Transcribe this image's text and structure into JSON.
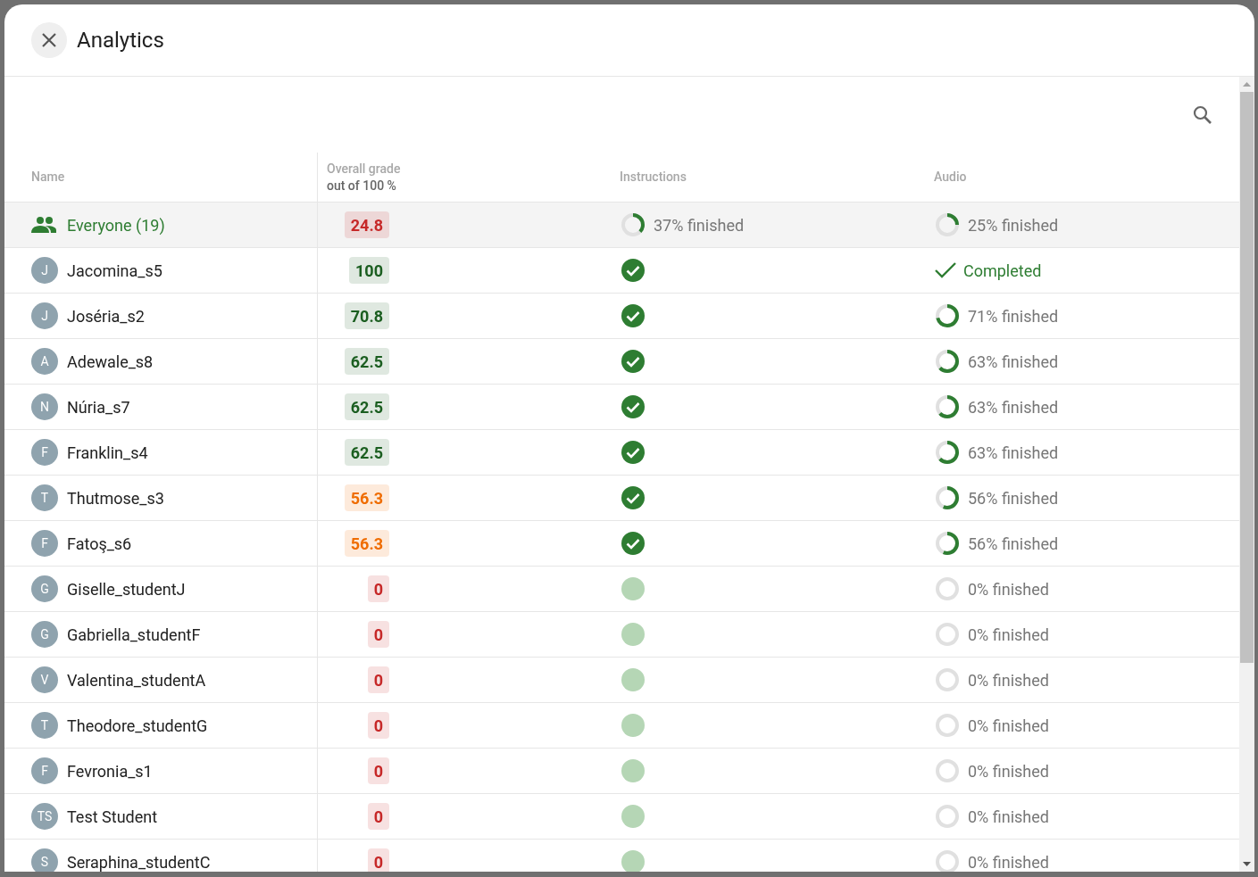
{
  "dialog": {
    "title": "Analytics"
  },
  "table": {
    "columns": [
      {
        "label": "Name"
      },
      {
        "label": "Overall grade",
        "sublabel": "out of 100 %"
      },
      {
        "label": "Instructions"
      },
      {
        "label": "Audio"
      }
    ],
    "rows": [
      {
        "kind": "group",
        "name": "Everyone (19)",
        "grade": "24.8",
        "color": "#c62828",
        "instructions": {
          "kind": "progress",
          "level": 0.37,
          "text": "37% finished"
        },
        "audio": {
          "kind": "progress",
          "level": 0.25,
          "text": "25% finished"
        }
      },
      {
        "kind": "student",
        "initials": "J",
        "name": "Jacomina_s5",
        "grade": "100",
        "color": "#1b5e20",
        "instructions": {
          "kind": "done"
        },
        "audio": {
          "kind": "completed",
          "text": "Completed"
        }
      },
      {
        "kind": "student",
        "initials": "J",
        "name": "Joséria_s2",
        "grade": "70.8",
        "color": "#1b5e20",
        "instructions": {
          "kind": "done"
        },
        "audio": {
          "kind": "progress",
          "level": 0.71,
          "text": "71% finished"
        }
      },
      {
        "kind": "student",
        "initials": "A",
        "name": "Adewale_s8",
        "grade": "62.5",
        "color": "#1b5e20",
        "instructions": {
          "kind": "done"
        },
        "audio": {
          "kind": "progress",
          "level": 0.63,
          "text": "63% finished"
        }
      },
      {
        "kind": "student",
        "initials": "N",
        "name": "Núria_s7",
        "grade": "62.5",
        "color": "#1b5e20",
        "instructions": {
          "kind": "done"
        },
        "audio": {
          "kind": "progress",
          "level": 0.63,
          "text": "63% finished"
        }
      },
      {
        "kind": "student",
        "initials": "F",
        "name": "Franklin_s4",
        "grade": "62.5",
        "color": "#1b5e20",
        "instructions": {
          "kind": "done"
        },
        "audio": {
          "kind": "progress",
          "level": 0.63,
          "text": "63% finished"
        }
      },
      {
        "kind": "student",
        "initials": "T",
        "name": "Thutmose_s3",
        "grade": "56.3",
        "color": "#ef6c00",
        "instructions": {
          "kind": "done"
        },
        "audio": {
          "kind": "progress",
          "level": 0.56,
          "text": "56% finished"
        }
      },
      {
        "kind": "student",
        "initials": "F",
        "name": "Fatoş_s6",
        "grade": "56.3",
        "color": "#ef6c00",
        "instructions": {
          "kind": "done"
        },
        "audio": {
          "kind": "progress",
          "level": 0.56,
          "text": "56% finished"
        }
      },
      {
        "kind": "student",
        "initials": "G",
        "name": "Giselle_studentJ",
        "grade": "0",
        "color": "#c62828",
        "instructions": {
          "kind": "not_started"
        },
        "audio": {
          "kind": "progress",
          "level": 0,
          "text": "0% finished"
        }
      },
      {
        "kind": "student",
        "initials": "G",
        "name": "Gabriella_studentF",
        "grade": "0",
        "color": "#c62828",
        "instructions": {
          "kind": "not_started"
        },
        "audio": {
          "kind": "progress",
          "level": 0,
          "text": "0% finished"
        }
      },
      {
        "kind": "student",
        "initials": "V",
        "name": "Valentina_studentA",
        "grade": "0",
        "color": "#c62828",
        "instructions": {
          "kind": "not_started"
        },
        "audio": {
          "kind": "progress",
          "level": 0,
          "text": "0% finished"
        }
      },
      {
        "kind": "student",
        "initials": "T",
        "name": "Theodore_studentG",
        "grade": "0",
        "color": "#c62828",
        "instructions": {
          "kind": "not_started"
        },
        "audio": {
          "kind": "progress",
          "level": 0,
          "text": "0% finished"
        }
      },
      {
        "kind": "student",
        "initials": "F",
        "name": "Fevronia_s1",
        "grade": "0",
        "color": "#c62828",
        "instructions": {
          "kind": "not_started"
        },
        "audio": {
          "kind": "progress",
          "level": 0,
          "text": "0% finished"
        }
      },
      {
        "kind": "student",
        "initials": "TS",
        "name": "Test Student",
        "grade": "0",
        "color": "#c62828",
        "instructions": {
          "kind": "not_started"
        },
        "audio": {
          "kind": "progress",
          "level": 0,
          "text": "0% finished"
        }
      },
      {
        "kind": "student",
        "initials": "S",
        "name": "Seraphina_studentC",
        "grade": "0",
        "color": "#c62828",
        "instructions": {
          "kind": "not_started"
        },
        "audio": {
          "kind": "progress",
          "level": 0,
          "text": "0% finished"
        }
      }
    ]
  }
}
